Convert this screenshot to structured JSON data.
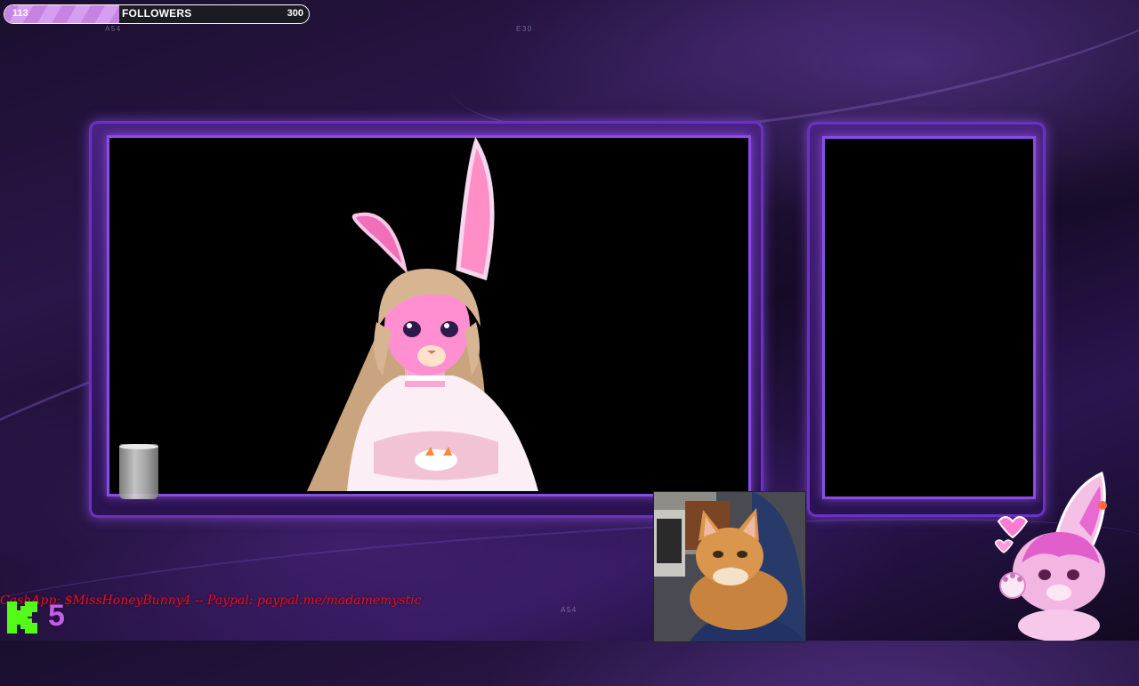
{
  "followers": {
    "current": "113",
    "label": "FOLLOWERS",
    "goal": "300",
    "progress_fraction": 0.377,
    "fill_color": "#c783e0"
  },
  "overlay_codes": {
    "top_left": "A54",
    "top_center": "E30",
    "bottom_center": "A54"
  },
  "donation_ticker": "CashApp: $MissHoneyBunny4  --  Paypal: paypal.me/madamemystic",
  "kick": {
    "logo": "kick-k-logo",
    "count": "5",
    "logo_color": "#53fc18",
    "count_color": "#c35ee8"
  },
  "scene": {
    "main_camera": "vtuber-bunny-avatar",
    "secondary_panel": "empty-black-panel",
    "webcam": "orange-cat-webcam",
    "mascot": "pink-bunny-mascot",
    "accent_color": "#8a4ce6"
  }
}
